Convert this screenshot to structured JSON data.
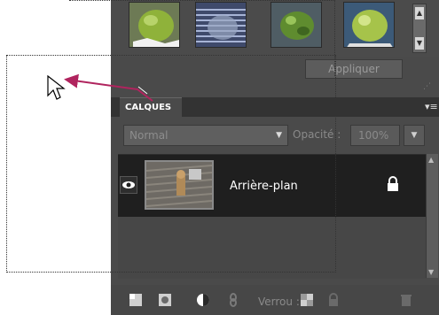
{
  "effects": {
    "apply_label": "Appliquer"
  },
  "layers_panel": {
    "tab_label": "CALQUES",
    "blend_mode": "Normal",
    "opacity_label": "Opacité :",
    "opacity_value": "100%",
    "layers": [
      {
        "name": "Arrière-plan"
      }
    ],
    "lock_label": "Verrou :"
  },
  "icons": {
    "eye": "eye-icon",
    "lock": "lock-icon",
    "menu": "panel-menu-icon",
    "cursor": "mouse-cursor-icon"
  },
  "colors": {
    "panel_bg": "#4a4a4a",
    "selected_layer_bg": "#1f1f1f",
    "drag_arrow": "#b0245e"
  }
}
